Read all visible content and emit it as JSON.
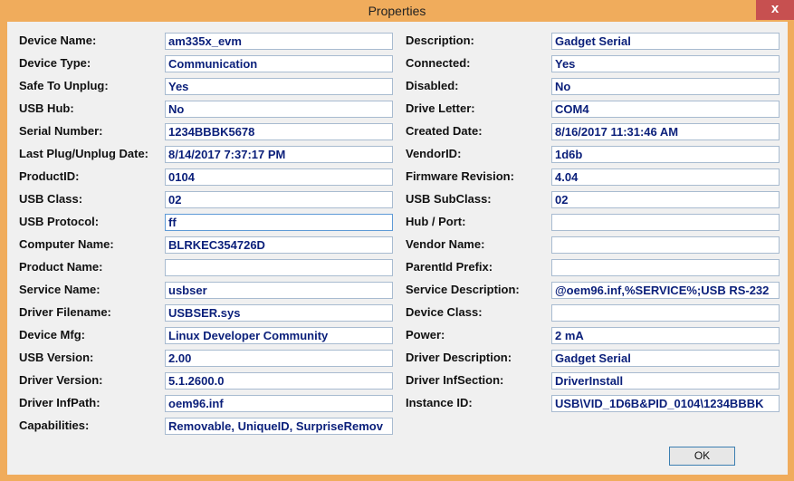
{
  "window": {
    "title": "Properties",
    "close_glyph": "x"
  },
  "left": [
    {
      "label": "Device Name:",
      "value": "am335x_evm"
    },
    {
      "label": "Device Type:",
      "value": "Communication"
    },
    {
      "label": "Safe To Unplug:",
      "value": "Yes"
    },
    {
      "label": "USB Hub:",
      "value": "No"
    },
    {
      "label": "Serial Number:",
      "value": "1234BBBK5678"
    },
    {
      "label": "Last Plug/Unplug Date:",
      "value": "8/14/2017 7:37:17 PM"
    },
    {
      "label": "ProductID:",
      "value": "0104"
    },
    {
      "label": "USB Class:",
      "value": "02"
    },
    {
      "label": "USB Protocol:",
      "value": "ff"
    },
    {
      "label": "Computer Name:",
      "value": "BLRKEC354726D"
    },
    {
      "label": "Product Name:",
      "value": ""
    },
    {
      "label": "Service Name:",
      "value": "usbser"
    },
    {
      "label": "Driver Filename:",
      "value": "USBSER.sys"
    },
    {
      "label": "Device Mfg:",
      "value": "Linux Developer Community"
    },
    {
      "label": "USB Version:",
      "value": "2.00"
    },
    {
      "label": "Driver Version:",
      "value": "5.1.2600.0"
    },
    {
      "label": "Driver InfPath:",
      "value": "oem96.inf"
    },
    {
      "label": "Capabilities:",
      "value": "Removable, UniqueID, SurpriseRemov"
    }
  ],
  "right": [
    {
      "label": "Description:",
      "value": "Gadget Serial"
    },
    {
      "label": "Connected:",
      "value": "Yes"
    },
    {
      "label": "Disabled:",
      "value": "No"
    },
    {
      "label": "Drive Letter:",
      "value": "COM4"
    },
    {
      "label": "Created Date:",
      "value": "8/16/2017 11:31:46 AM"
    },
    {
      "label": "VendorID:",
      "value": "1d6b"
    },
    {
      "label": "Firmware Revision:",
      "value": "4.04"
    },
    {
      "label": "USB SubClass:",
      "value": "02"
    },
    {
      "label": "Hub / Port:",
      "value": ""
    },
    {
      "label": "Vendor Name:",
      "value": ""
    },
    {
      "label": "ParentId Prefix:",
      "value": ""
    },
    {
      "label": "Service Description:",
      "value": "@oem96.inf,%SERVICE%;USB RS-232"
    },
    {
      "label": "Device Class:",
      "value": ""
    },
    {
      "label": "Power:",
      "value": "2 mA"
    },
    {
      "label": "Driver Description:",
      "value": "Gadget Serial"
    },
    {
      "label": "Driver InfSection:",
      "value": "DriverInstall"
    },
    {
      "label": "Instance ID:",
      "value": "USB\\VID_1D6B&PID_0104\\1234BBBK"
    }
  ],
  "buttons": {
    "ok": "OK"
  }
}
